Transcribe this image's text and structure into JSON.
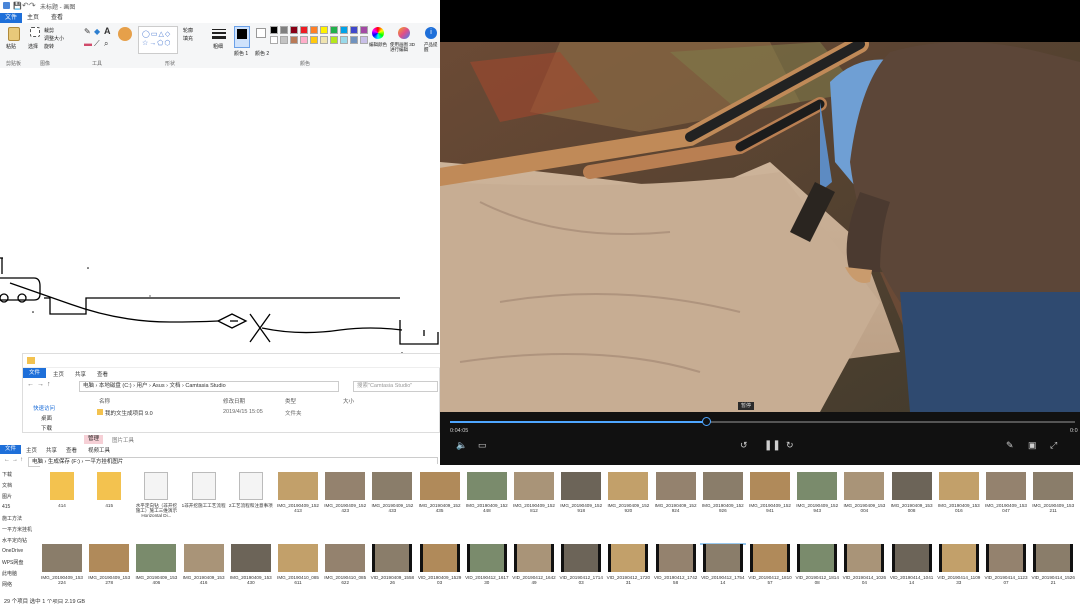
{
  "paint": {
    "title": "未标题 - 画图",
    "tabs": [
      "文件",
      "主页",
      "查看"
    ],
    "groups": [
      "剪贴板",
      "图像",
      "工具",
      "形状",
      "颜色"
    ],
    "buttons": {
      "paste": "粘贴",
      "select": "选择",
      "crop": "裁剪",
      "resize": "调整大小",
      "rotate": "旋转",
      "outline": "轮廓",
      "fill": "填充",
      "size": "粗细",
      "color1": "颜色 1",
      "color2": "颜色 2",
      "edit_colors": "编辑颜色",
      "edit_3d": "使用画图 3D 进行编辑",
      "product_alert": "产品提醒"
    },
    "palette": [
      "#000000",
      "#7f7f7f",
      "#880015",
      "#ed1c24",
      "#ff7f27",
      "#fff200",
      "#22b14c",
      "#00a2e8",
      "#3f48cc",
      "#a349a4",
      "#ffffff",
      "#c3c3c3",
      "#b97a57",
      "#ffaec9",
      "#ffc90e",
      "#efe4b0",
      "#b5e61d",
      "#99d9ea",
      "#7092be",
      "#c8bfe7"
    ]
  },
  "explorer1": {
    "tabs": [
      "文件",
      "主页",
      "共享",
      "查看"
    ],
    "address": [
      "电脑",
      "本地磁盘 (C:)",
      "用户",
      "Asus",
      "文档",
      "Camtasia Studio"
    ],
    "search_placeholder": "搜索\"Camtasia Studio\"",
    "nav": [
      "快速访问",
      "桌面",
      "下载"
    ],
    "columns": [
      "名称",
      "修改日期",
      "类型",
      "大小"
    ],
    "rows": [
      {
        "name": "我的文生成项目 9.0",
        "date": "2019/4/15 15:05",
        "type": "文件夹",
        "size": ""
      }
    ]
  },
  "explorer2": {
    "ribbon_badge": "管理",
    "ribbon_badge2": "图片工具",
    "tabs": [
      "文件",
      "主页",
      "共享",
      "查看",
      "视频工具"
    ],
    "address": [
      "电脑",
      "生成保存 (F:)",
      "一平方挂机图片"
    ],
    "nav": [
      "下载",
      "文档",
      "图片",
      "415",
      "施工方法",
      "一平方米挂机",
      "水平定向钻",
      "OneDrive",
      "WPS网盘",
      "此电脑",
      "网络"
    ],
    "status": "29 个项目   选中 1 个项目  2.19 GB"
  },
  "files_row1": [
    {
      "name": "414",
      "kind": "folder"
    },
    {
      "name": "415",
      "kind": "folder"
    },
    {
      "name": "水平定向钻（非开挖施工）施工三维演示 Horizontal Di...",
      "kind": "doc"
    },
    {
      "name": "1非开挖施工工艺流程",
      "kind": "doc"
    },
    {
      "name": "2工艺流程和注意事项",
      "kind": "doc"
    },
    {
      "name": "IMG_20190409_152413",
      "kind": "photo"
    },
    {
      "name": "IMG_20190409_152423",
      "kind": "photo"
    },
    {
      "name": "IMG_20190409_152433",
      "kind": "photo"
    },
    {
      "name": "IMG_20190409_152435",
      "kind": "photo"
    },
    {
      "name": "IMG_20190409_152448",
      "kind": "photo"
    },
    {
      "name": "IMG_20190409_152812",
      "kind": "photo"
    },
    {
      "name": "IMG_20190409_152918",
      "kind": "photo"
    },
    {
      "name": "IMG_20190409_152920",
      "kind": "photo"
    },
    {
      "name": "IMG_20190409_152924",
      "kind": "photo"
    },
    {
      "name": "IMG_20190409_152926",
      "kind": "photo"
    },
    {
      "name": "IMG_20190409_152941",
      "kind": "photo"
    },
    {
      "name": "IMG_20190409_152943",
      "kind": "photo"
    },
    {
      "name": "IMG_20190409_153004",
      "kind": "photo"
    },
    {
      "name": "IMG_20190409_153008",
      "kind": "photo"
    },
    {
      "name": "IMG_20190409_153016",
      "kind": "photo"
    },
    {
      "name": "IMG_20190409_153047",
      "kind": "photo"
    },
    {
      "name": "IMG_20190409_153211",
      "kind": "photo"
    }
  ],
  "files_row2": [
    {
      "name": "IMG_20190409_153224",
      "kind": "photo"
    },
    {
      "name": "IMG_20190409_153278",
      "kind": "photo"
    },
    {
      "name": "IMG_20190409_153406",
      "kind": "photo"
    },
    {
      "name": "IMG_20190409_153416",
      "kind": "photo"
    },
    {
      "name": "IMG_20190409_153430",
      "kind": "photo"
    },
    {
      "name": "IMG_20190410_085611",
      "kind": "photo"
    },
    {
      "name": "IMG_20190410_085622",
      "kind": "photo"
    },
    {
      "name": "VID_20190409_155826",
      "kind": "video"
    },
    {
      "name": "VID_20190409_152903",
      "kind": "video"
    },
    {
      "name": "VID_20190412_161730",
      "kind": "video"
    },
    {
      "name": "VID_20190412_164249",
      "kind": "video"
    },
    {
      "name": "VID_20190412_171403",
      "kind": "video"
    },
    {
      "name": "VID_20190412_172031",
      "kind": "video"
    },
    {
      "name": "VID_20190412_174258",
      "kind": "video"
    },
    {
      "name": "VID_20190412_175414",
      "kind": "video",
      "selected": true
    },
    {
      "name": "VID_20190412_181057",
      "kind": "video"
    },
    {
      "name": "VID_20190412_181408",
      "kind": "video"
    },
    {
      "name": "VID_20190414_102604",
      "kind": "video"
    },
    {
      "name": "VID_20190414_104114",
      "kind": "video"
    },
    {
      "name": "VID_20190414_110933",
      "kind": "video"
    },
    {
      "name": "VID_20190414_112307",
      "kind": "video"
    },
    {
      "name": "VID_20190414_152621",
      "kind": "video"
    }
  ],
  "player": {
    "current_time": "0:04:05",
    "end_time": "0:0",
    "progress": 0.41,
    "tooltip": "暂停",
    "icons": [
      "volume-icon",
      "subtitles-icon",
      "rewind-10-icon",
      "pause-icon",
      "forward-30-icon",
      "edit-icon",
      "miniplayer-icon",
      "fullscreen-icon"
    ]
  }
}
